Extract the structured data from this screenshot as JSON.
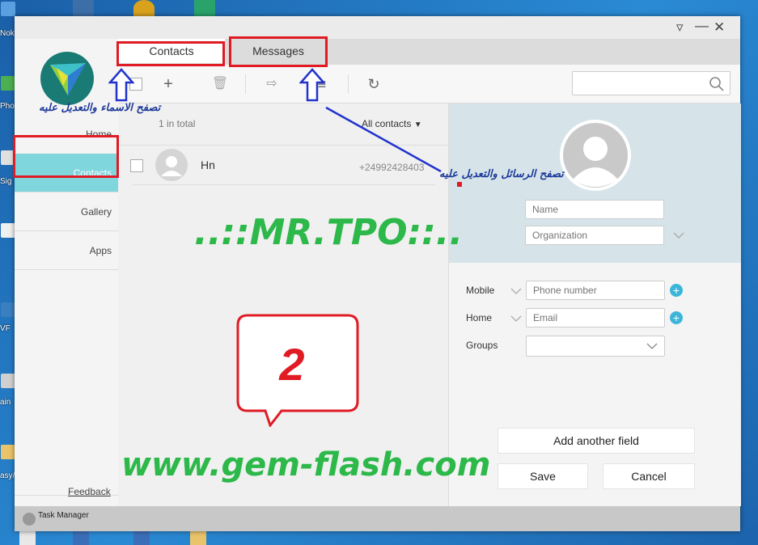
{
  "desktop": {
    "labels": [
      "Nok",
      "Pho",
      "Sig",
      "VF",
      "ain",
      "asy/"
    ],
    "taskbar_items": 6
  },
  "window": {
    "controls": [
      "▿",
      "—",
      "✕"
    ]
  },
  "sidebar": {
    "items": [
      {
        "label": "Home"
      },
      {
        "label": "Contacts"
      },
      {
        "label": "Gallery"
      },
      {
        "label": "Apps"
      }
    ],
    "feedback": "Feedback"
  },
  "tabs": [
    {
      "label": "Contacts"
    },
    {
      "label": "Messages"
    }
  ],
  "toolbar": {
    "add": "+",
    "delete": "🗑",
    "export": "⇨",
    "menu": "≡",
    "refresh": "↻",
    "search_value": ""
  },
  "list": {
    "count_text": "1 in total",
    "filter_label": "All contacts",
    "contacts": [
      {
        "name": "Hn",
        "phone": "+24992428403"
      }
    ]
  },
  "detail": {
    "name_placeholder": "Name",
    "org_placeholder": "Organization",
    "mobile_label": "Mobile",
    "phone_placeholder": "Phone number",
    "home_label": "Home",
    "email_placeholder": "Email",
    "groups_label": "Groups",
    "add_field": "Add another field",
    "save": "Save",
    "cancel": "Cancel"
  },
  "bottombar": {
    "task_manager": "Task Manager"
  },
  "annotations": {
    "watermark": "..::MR.TPO::..",
    "site": "www.gem-flash.com",
    "step_number": "2",
    "note_contacts": "تصفح الاسماء والتعديل عليه",
    "note_messages": "تصفح الرسائل والتعديل عليه"
  },
  "colors": {
    "accent": "#7fd6dd",
    "highlight_red": "#e01b24",
    "watermark_green": "#2db84a",
    "annotation_blue": "#1e3a9a"
  }
}
